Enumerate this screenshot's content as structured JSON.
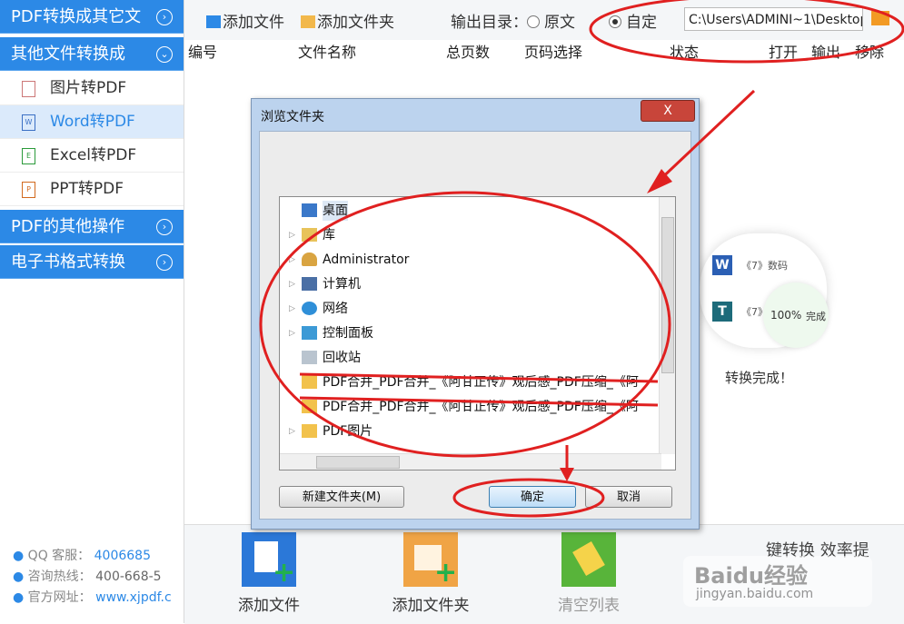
{
  "sidebar": {
    "sections": [
      {
        "label": "PDF转换成其它文"
      },
      {
        "label": "其他文件转换成"
      },
      {
        "label": "PDF的其他操作"
      },
      {
        "label": "电子书格式转换"
      }
    ],
    "items": [
      {
        "label": "图片转PDF"
      },
      {
        "label": "Word转PDF"
      },
      {
        "label": "Excel转PDF"
      },
      {
        "label": "PPT转PDF"
      }
    ],
    "contacts": [
      {
        "label": "QQ 客服：",
        "value": "4006685"
      },
      {
        "label": "咨询热线：",
        "value": "400-668-5"
      },
      {
        "label": "官方网址：",
        "value": "www.xjpdf.c"
      }
    ]
  },
  "toolbar": {
    "add_file": "添加文件",
    "add_folder": "添加文件夹",
    "output_label": "输出目录：",
    "option_original": "原文",
    "option_custom": "自定",
    "output_path": "C:\\Users\\ADMINI~1\\Desktop"
  },
  "table_header": [
    "编号",
    "文件名称",
    "总页数",
    "页码选择",
    "状态",
    "打开",
    "输出",
    "移除"
  ],
  "promo": {
    "item1": "《7》数码",
    "item2": "《7》",
    "progress": "100%",
    "done_short": "完成",
    "done": "转换完成！",
    "slogan": "键转换  效率提"
  },
  "dialog": {
    "title": "浏览文件夹",
    "close": "X",
    "tree": [
      {
        "label": "桌面"
      },
      {
        "label": "库"
      },
      {
        "label": "Administrator"
      },
      {
        "label": "计算机"
      },
      {
        "label": "网络"
      },
      {
        "label": "控制面板"
      },
      {
        "label": "回收站"
      },
      {
        "label": "PDF合并_PDF合并_《阿甘正传》观后感_PDF压缩_《阿"
      },
      {
        "label": "PDF合并_PDF合并_《阿甘正传》观后感_PDF压缩_《阿"
      },
      {
        "label": "PDF图片"
      }
    ],
    "new_folder": "新建文件夹(M)",
    "ok": "确定",
    "cancel": "取消"
  },
  "bottom": {
    "add_file": "添加文件",
    "add_folder": "添加文件夹",
    "clear_list": "清空列表"
  },
  "watermark": {
    "brand": "Baidu经验",
    "url": "jingyan.baidu.com"
  },
  "colors": {
    "accent": "#2c89e6",
    "annotation": "#e02020"
  }
}
